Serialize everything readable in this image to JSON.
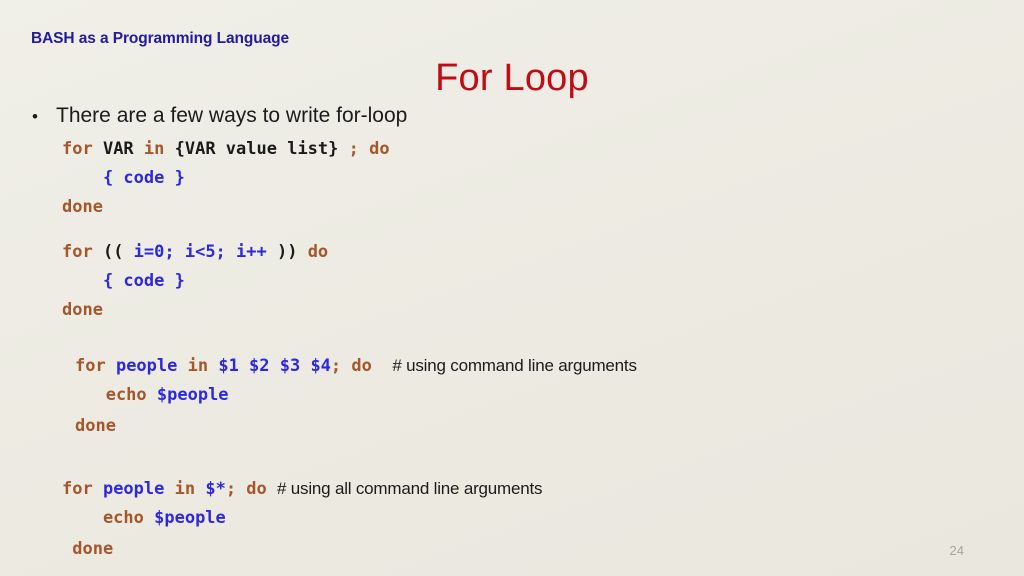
{
  "slide": {
    "header_title": "BASH as a Programming Language",
    "title": "For Loop",
    "bullet_marker": "•",
    "bullet_text": "There are a few ways to write for-loop",
    "slide_number": "24",
    "colors": {
      "background": "#edece4",
      "header": "#221b9c",
      "title": "#c00c14",
      "keyword": "#a4562c",
      "literal": "#1a1a1a",
      "variable": "#2d28e0",
      "comment": "#1b1b1b",
      "slide_number": "#a8a69c"
    }
  },
  "code_blocks": [
    {
      "id": "for-in-list",
      "lines": [
        {
          "id": "b1l1",
          "tokens": [
            {
              "text": "for ",
              "kind": "kw"
            },
            {
              "text": "VAR ",
              "kind": "lit"
            },
            {
              "text": "in ",
              "kind": "kw"
            },
            {
              "text": "{VAR value list} ",
              "kind": "lit"
            },
            {
              "text": "; do",
              "kind": "kw"
            }
          ]
        },
        {
          "id": "b1l2",
          "tokens": [
            {
              "text": "    { code }",
              "kind": "var"
            }
          ]
        },
        {
          "id": "b1l3",
          "tokens": [
            {
              "text": "done",
              "kind": "kw"
            }
          ]
        }
      ]
    },
    {
      "id": "for-c-style",
      "lines": [
        {
          "id": "b2l1",
          "tokens": [
            {
              "text": "for ",
              "kind": "kw"
            },
            {
              "text": "(( ",
              "kind": "lit"
            },
            {
              "text": "i=0; i<5; i++ ",
              "kind": "var"
            },
            {
              "text": ")) ",
              "kind": "lit"
            },
            {
              "text": "do",
              "kind": "kw"
            }
          ]
        },
        {
          "id": "b2l2",
          "tokens": [
            {
              "text": "    { code }",
              "kind": "var"
            }
          ]
        },
        {
          "id": "b2l3",
          "tokens": [
            {
              "text": "done",
              "kind": "kw"
            }
          ]
        }
      ]
    },
    {
      "id": "for-positional-args",
      "lines": [
        {
          "id": "b3l1",
          "tokens": [
            {
              "text": "for ",
              "kind": "kw"
            },
            {
              "text": "people ",
              "kind": "var"
            },
            {
              "text": "in ",
              "kind": "kw"
            },
            {
              "text": "$1 $2 $3 $4",
              "kind": "var"
            },
            {
              "text": "; do  ",
              "kind": "kw"
            },
            {
              "text": "# using command line arguments",
              "kind": "comment"
            }
          ]
        },
        {
          "id": "b3l2",
          "tokens": [
            {
              "text": "   echo ",
              "kind": "kw"
            },
            {
              "text": "$people",
              "kind": "var"
            }
          ]
        },
        {
          "id": "b3l3",
          "tokens": [
            {
              "text": "done",
              "kind": "kw"
            }
          ]
        }
      ]
    },
    {
      "id": "for-all-args",
      "lines": [
        {
          "id": "b4l1",
          "tokens": [
            {
              "text": "for ",
              "kind": "kw"
            },
            {
              "text": "people ",
              "kind": "var"
            },
            {
              "text": "in ",
              "kind": "kw"
            },
            {
              "text": "$*",
              "kind": "var"
            },
            {
              "text": "; do ",
              "kind": "kw"
            },
            {
              "text": "# using all command line arguments",
              "kind": "comment"
            }
          ]
        },
        {
          "id": "b4l2",
          "tokens": [
            {
              "text": "    echo ",
              "kind": "kw"
            },
            {
              "text": "$people",
              "kind": "var"
            }
          ]
        },
        {
          "id": "b4l3",
          "tokens": [
            {
              "text": " done",
              "kind": "kw"
            }
          ]
        }
      ]
    }
  ]
}
